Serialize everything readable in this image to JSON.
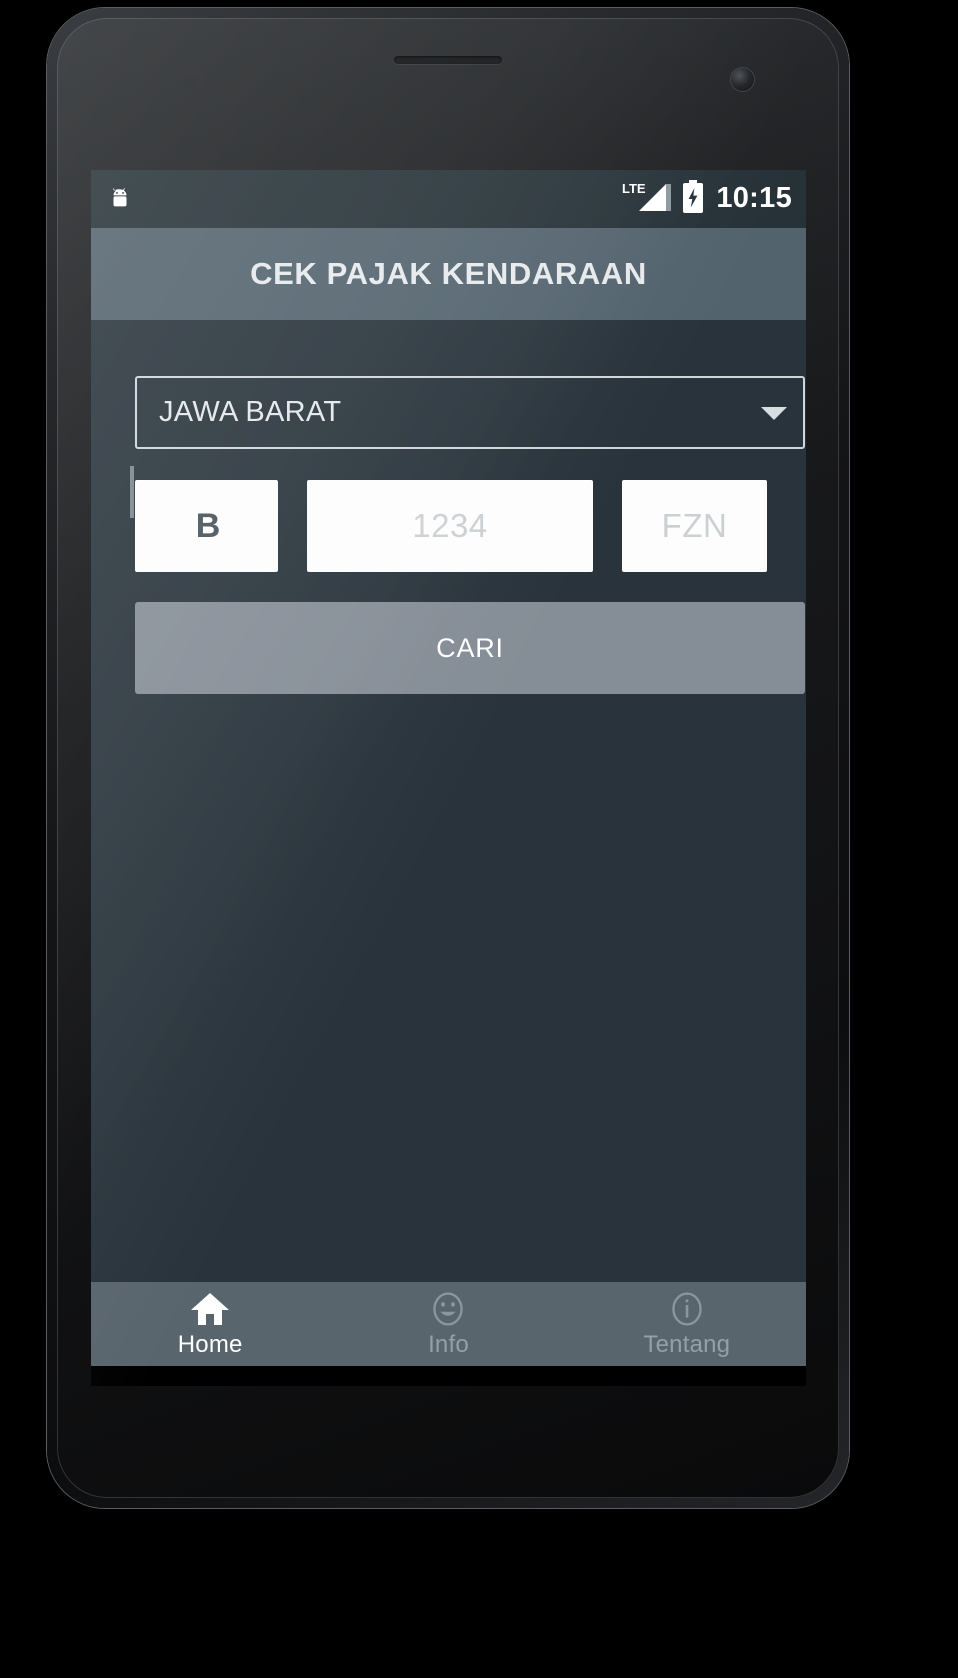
{
  "status_bar": {
    "notification_icon": "android-logo-icon",
    "network_label": "LTE",
    "signal_icon": "signal-bars-icon",
    "battery_icon": "battery-charging-icon",
    "clock": "10:15"
  },
  "app_bar": {
    "title": "CEK PAJAK KENDARAAN"
  },
  "form": {
    "state_spinner": {
      "value": "JAWA BARAT",
      "caret_icon": "chevron-down-icon"
    },
    "plate_prefix": {
      "value": "B",
      "placeholder": "B"
    },
    "plate_number": {
      "value": "",
      "placeholder": "1234"
    },
    "plate_suffix": {
      "value": "",
      "placeholder": "FZN"
    },
    "search_button_label": "CARI"
  },
  "bottom_tabs": [
    {
      "label": "Home",
      "icon": "home-icon",
      "active": true
    },
    {
      "label": "Info",
      "icon": "smiley-face-icon",
      "active": false
    },
    {
      "label": "Tentang",
      "icon": "info-circle-icon",
      "active": false
    }
  ],
  "android_nav": [
    {
      "name": "back-button",
      "icon": "triangle-back-icon"
    },
    {
      "name": "home-button",
      "icon": "circle-home-icon"
    },
    {
      "name": "recents-button",
      "icon": "square-recents-icon"
    }
  ],
  "colors": {
    "status_bar_bg": "#263238",
    "app_bar_bg": "#53636e",
    "content_bg": "#28333b",
    "button_bg": "#858d96",
    "tab_bar_bg": "#59656d",
    "accent_text": "#e6eaec",
    "inactive_text": "#93a0a7"
  }
}
